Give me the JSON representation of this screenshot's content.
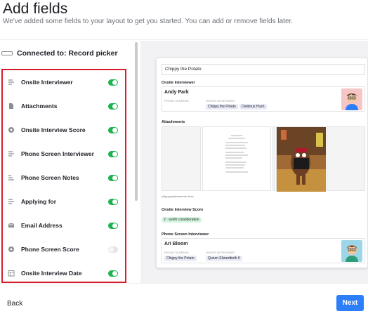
{
  "header": {
    "title": "Add fields",
    "subtitle": "We've added some fields to your layout to get you started. You can add or remove fields later."
  },
  "connection": {
    "label": "Connected to: Record picker"
  },
  "fields": [
    {
      "label": "Onsite Interviewer",
      "icon": "linked-record-icon",
      "enabled": true
    },
    {
      "label": "Attachments",
      "icon": "attachment-icon",
      "enabled": true
    },
    {
      "label": "Onsite Interview Score",
      "icon": "single-select-icon",
      "enabled": true
    },
    {
      "label": "Phone Screen Interviewer",
      "icon": "linked-record-icon",
      "enabled": true
    },
    {
      "label": "Phone Screen Notes",
      "icon": "long-text-icon",
      "enabled": true
    },
    {
      "label": "Applying for",
      "icon": "linked-record-icon",
      "enabled": true
    },
    {
      "label": "Email Address",
      "icon": "email-icon",
      "enabled": true
    },
    {
      "label": "Phone Screen Score",
      "icon": "single-select-icon",
      "enabled": false
    },
    {
      "label": "Onsite Interview Date",
      "icon": "date-icon",
      "enabled": true
    }
  ],
  "preview": {
    "record_title": "Chippy the Potato",
    "onsite_interviewer": {
      "section_label": "Onsite Interviewer",
      "name": "Andy Park",
      "col1_header": "PHONE SCREENS",
      "col2_header": "ONSITE INTERVIEWS",
      "chips": [
        "Chippy the Potato",
        "Owldous Hush"
      ]
    },
    "attachments": {
      "section_label": "Attachments",
      "caption": "chippypotatoresume.docx"
    },
    "onsite_interview_score": {
      "section_label": "Onsite Interview Score",
      "value": "2 · worth consideration"
    },
    "phone_screen_interviewer": {
      "section_label": "Phone Screen Interviewer",
      "name": "Ari Bloom",
      "col1_header": "PHONE SCREENS",
      "col2_header": "ONSITE INTERVIEWS",
      "chips_col1": [
        "Chippy the Potato"
      ],
      "chips_col2": [
        "Queen Elizardbeth II"
      ]
    }
  },
  "footer": {
    "back_label": "Back",
    "next_label": "Next"
  },
  "colors": {
    "toggle_on": "#1db44f",
    "toggle_off": "#e4e5e8",
    "highlight_border": "#d81e2c",
    "primary_button": "#2d7ff9",
    "chip_bg": "#e8ebf6",
    "score_pill_bg": "#d4f5df"
  }
}
